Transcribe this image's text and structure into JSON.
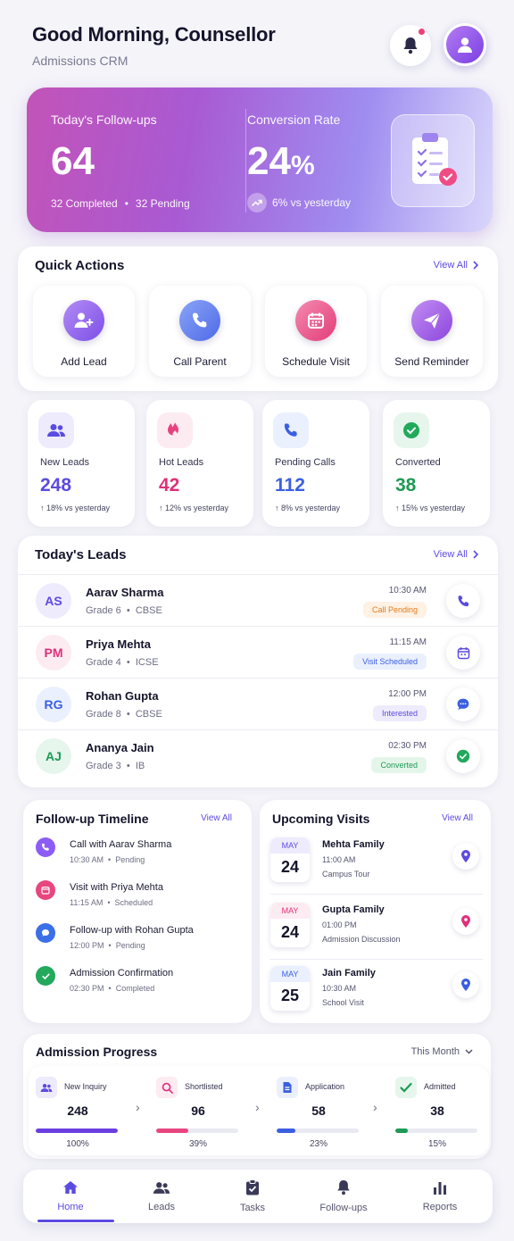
{
  "header": {
    "greeting": "Good Morning, Counsellor",
    "subtitle": "Admissions CRM"
  },
  "hero": {
    "followups_label": "Today's Follow-ups",
    "followups_value": "64",
    "completed": "32 Completed",
    "pending": "32 Pending",
    "conversion_label": "Conversion Rate",
    "conversion_value": "24",
    "conversion_unit": "%",
    "conversion_delta": "6% vs yesterday"
  },
  "quick_actions": {
    "title": "Quick Actions",
    "view_all": "View All",
    "items": [
      {
        "label": "Add Lead",
        "icon": "add-user-icon",
        "color": "#8b5cf6"
      },
      {
        "label": "Call Parent",
        "icon": "phone-icon",
        "color": "#4f74e8"
      },
      {
        "label": "Schedule Visit",
        "icon": "calendar-icon",
        "color": "#e8467f"
      },
      {
        "label": "Send Reminder",
        "icon": "send-icon",
        "color": "#9a4fe0"
      }
    ]
  },
  "stats": [
    {
      "label": "New Leads",
      "value": "248",
      "delta": "↑ 18% vs yesterday",
      "color": "#5b4be0",
      "icon": "users-icon"
    },
    {
      "label": "Hot Leads",
      "value": "42",
      "delta": "↑ 12% vs yesterday",
      "color": "#e0307a",
      "icon": "fire-icon"
    },
    {
      "label": "Pending Calls",
      "value": "112",
      "delta": "↑ 8% vs yesterday",
      "color": "#3b5fe0",
      "icon": "phone-icon"
    },
    {
      "label": "Converted",
      "value": "38",
      "delta": "↑ 15% vs yesterday",
      "color": "#1e9a55",
      "icon": "check-circle-icon"
    }
  ],
  "leads": {
    "title": "Today's Leads",
    "view_all": "View All",
    "items": [
      {
        "initials": "AS",
        "name": "Aarav Sharma",
        "grade": "Grade 6",
        "board": "CBSE",
        "time": "10:30 AM",
        "status": "Call Pending"
      },
      {
        "initials": "PM",
        "name": "Priya Mehta",
        "grade": "Grade 4",
        "board": "ICSE",
        "time": "11:15 AM",
        "status": "Visit Scheduled"
      },
      {
        "initials": "RG",
        "name": "Rohan Gupta",
        "grade": "Grade 8",
        "board": "CBSE",
        "time": "12:00 PM",
        "status": "Interested"
      },
      {
        "initials": "AJ",
        "name": "Ananya Jain",
        "grade": "Grade 3",
        "board": "IB",
        "time": "02:30 PM",
        "status": "Converted"
      }
    ]
  },
  "timeline": {
    "title": "Follow-up Timeline",
    "view_all": "View All",
    "items": [
      {
        "title": "Call with Aarav Sharma",
        "time": "10:30 AM",
        "status": "Pending"
      },
      {
        "title": "Visit with Priya Mehta",
        "time": "11:15 AM",
        "status": "Scheduled"
      },
      {
        "title": "Follow-up with Rohan Gupta",
        "time": "12:00 PM",
        "status": "Pending"
      },
      {
        "title": "Admission Confirmation",
        "time": "02:30 PM",
        "status": "Completed"
      }
    ]
  },
  "visits": {
    "title": "Upcoming Visits",
    "view_all": "View All",
    "items": [
      {
        "month": "MAY",
        "day": "24",
        "name": "Mehta Family",
        "time": "11:00 AM",
        "type": "Campus Tour"
      },
      {
        "month": "MAY",
        "day": "24",
        "name": "Gupta Family",
        "time": "01:00 PM",
        "type": "Admission Discussion"
      },
      {
        "month": "MAY",
        "day": "25",
        "name": "Jain Family",
        "time": "10:30 AM",
        "type": "School Visit"
      }
    ]
  },
  "progress": {
    "title": "Admission Progress",
    "period": "This Month",
    "stages": [
      {
        "label": "New Inquiry",
        "value": "248",
        "percent_label": "100%",
        "fraction": 1.0,
        "color": "#6a3fe0"
      },
      {
        "label": "Shortlisted",
        "value": "96",
        "percent_label": "39%",
        "fraction": 0.39,
        "color": "#e8467f"
      },
      {
        "label": "Application",
        "value": "58",
        "percent_label": "23%",
        "fraction": 0.23,
        "color": "#3b5fe0"
      },
      {
        "label": "Admitted",
        "value": "38",
        "percent_label": "15%",
        "fraction": 0.15,
        "color": "#1e9a55"
      }
    ]
  },
  "nav": {
    "items": [
      "Home",
      "Leads",
      "Tasks",
      "Follow-ups",
      "Reports"
    ],
    "active": "Home"
  },
  "sep": "•"
}
